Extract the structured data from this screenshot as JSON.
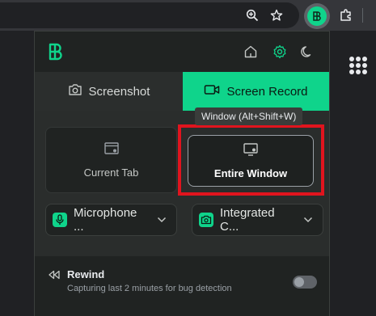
{
  "colors": {
    "accent": "#0fd48b",
    "highlight": "#e0141e"
  },
  "browser": {
    "icons": [
      "zoom-icon",
      "star-icon",
      "extension-logo-icon",
      "puzzle-icon",
      "apps-grid-icon"
    ]
  },
  "popup": {
    "tabs": [
      {
        "label": "Screenshot",
        "icon": "camera-icon",
        "active": false
      },
      {
        "label": "Screen Record",
        "icon": "video-icon",
        "active": true
      }
    ],
    "tooltip": "Window (Alt+Shift+W)",
    "options": [
      {
        "label": "Current Tab",
        "icon": "browser-tab-icon"
      },
      {
        "label": "Entire Window",
        "icon": "monitor-icon",
        "selected": true
      }
    ],
    "microphone": {
      "label": "Microphone ...",
      "icon": "microphone-icon"
    },
    "camera": {
      "label": "Integrated C...",
      "icon": "webcam-icon"
    },
    "rewind": {
      "title": "Rewind",
      "description": "Capturing last 2 minutes for bug detection",
      "enabled": false
    }
  }
}
